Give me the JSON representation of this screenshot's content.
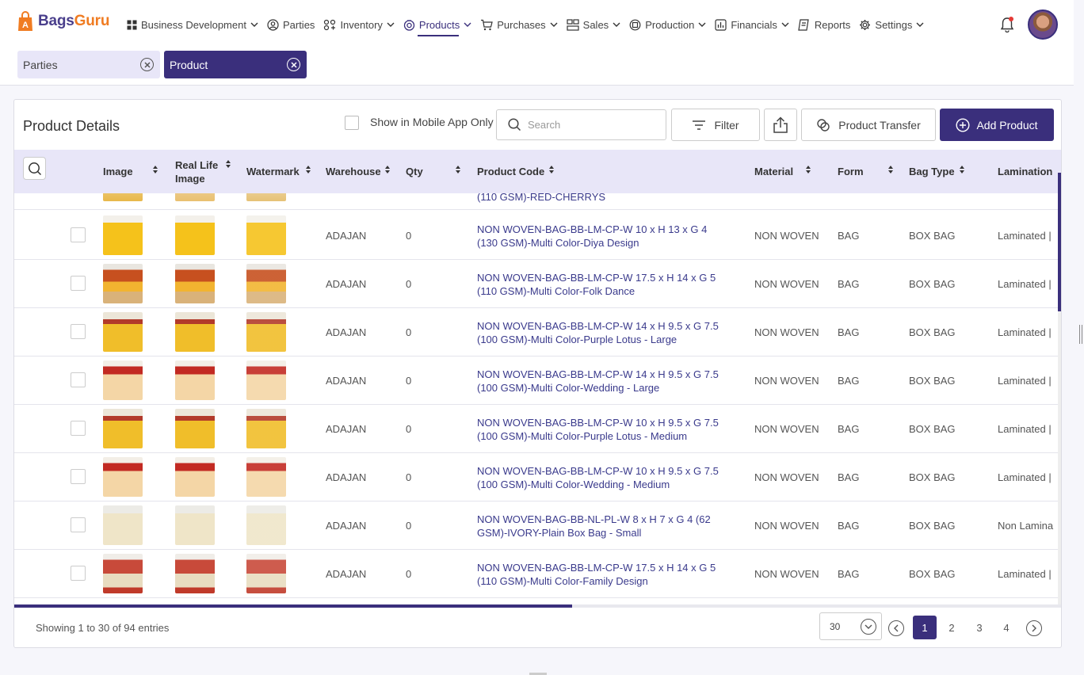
{
  "app": {
    "brand_part1": "Bags",
    "brand_part2": "Guru"
  },
  "nav": [
    {
      "label": "Business Development",
      "icon": "grid-icon",
      "dropdown": true
    },
    {
      "label": "Parties",
      "icon": "user-circle-icon",
      "dropdown": false
    },
    {
      "label": "Inventory",
      "icon": "inventory-icon",
      "dropdown": true
    },
    {
      "label": "Products",
      "icon": "product-icon",
      "dropdown": true,
      "active": true
    },
    {
      "label": "Purchases",
      "icon": "cart-icon",
      "dropdown": true
    },
    {
      "label": "Sales",
      "icon": "sales-icon",
      "dropdown": true
    },
    {
      "label": "Production",
      "icon": "production-icon",
      "dropdown": true
    },
    {
      "label": "Financials",
      "icon": "financials-icon",
      "dropdown": true
    },
    {
      "label": "Reports",
      "icon": "reports-icon",
      "dropdown": false
    },
    {
      "label": "Settings",
      "icon": "gear-icon",
      "dropdown": true
    }
  ],
  "tabs": [
    {
      "label": "Parties"
    },
    {
      "label": "Product"
    }
  ],
  "page": {
    "title": "Product Details",
    "mobile_only_label": "Show in Mobile App Only",
    "search_placeholder": "Search",
    "filter_label": "Filter",
    "transfer_label": "Product Transfer",
    "add_label": "Add Product"
  },
  "columns": [
    "Image",
    "Real Life Image",
    "Watermark",
    "Warehouse",
    "Qty",
    "Product Code",
    "Material",
    "Form",
    "Bag Type",
    "Lamination"
  ],
  "partial_row": {
    "product_code_tail": "(110 GSM)-RED-CHERRYS"
  },
  "rows": [
    {
      "warehouse": "ADAJAN",
      "qty": "0",
      "code1": "NON WOVEN-BAG-BB-LM-CP-W 10 x H 13 x G 4",
      "code2": "(130 GSM)-Multi Color-Diya Design",
      "material": "NON WOVEN",
      "form": "BAG",
      "bag_type": "BOX BAG",
      "lamination": "Laminated |",
      "img": "yellow"
    },
    {
      "warehouse": "ADAJAN",
      "qty": "0",
      "code1": "NON WOVEN-BAG-BB-LM-CP-W 17.5 x H 14 x G 5",
      "code2": "(110 GSM)-Multi Color-Folk Dance",
      "material": "NON WOVEN",
      "form": "BAG",
      "bag_type": "BOX BAG",
      "lamination": "Laminated |",
      "img": "folk"
    },
    {
      "warehouse": "ADAJAN",
      "qty": "0",
      "code1": "NON WOVEN-BAG-BB-LM-CP-W 14 x H 9.5 x G 7.5",
      "code2": "(100 GSM)-Multi Color-Purple Lotus - Large",
      "material": "NON WOVEN",
      "form": "BAG",
      "bag_type": "BOX BAG",
      "lamination": "Laminated |",
      "img": "lotus"
    },
    {
      "warehouse": "ADAJAN",
      "qty": "0",
      "code1": "NON WOVEN-BAG-BB-LM-CP-W 14 x H 9.5 x G 7.5",
      "code2": "(100 GSM)-Multi Color-Wedding - Large",
      "material": "NON WOVEN",
      "form": "BAG",
      "bag_type": "BOX BAG",
      "lamination": "Laminated |",
      "img": "wedding"
    },
    {
      "warehouse": "ADAJAN",
      "qty": "0",
      "code1": "NON WOVEN-BAG-BB-LM-CP-W 10 x H 9.5 x G 7.5",
      "code2": "(100 GSM)-Multi Color-Purple Lotus - Medium",
      "material": "NON WOVEN",
      "form": "BAG",
      "bag_type": "BOX BAG",
      "lamination": "Laminated |",
      "img": "lotus"
    },
    {
      "warehouse": "ADAJAN",
      "qty": "0",
      "code1": "NON WOVEN-BAG-BB-LM-CP-W 10 x H 9.5 x G 7.5",
      "code2": "(100 GSM)-Multi Color-Wedding - Medium",
      "material": "NON WOVEN",
      "form": "BAG",
      "bag_type": "BOX BAG",
      "lamination": "Laminated |",
      "img": "wedding"
    },
    {
      "warehouse": "ADAJAN",
      "qty": "0",
      "code1": "NON WOVEN-BAG-BB-NL-PL-W 8 x H 7 x G 4 (62",
      "code2": "GSM)-IVORY-Plain Box Bag - Small",
      "material": "NON WOVEN",
      "form": "BAG",
      "bag_type": "BOX BAG",
      "lamination": "Non Lamina",
      "img": "ivory"
    },
    {
      "warehouse": "ADAJAN",
      "qty": "0",
      "code1": "NON WOVEN-BAG-BB-LM-CP-W 17.5 x H 14 x G 5",
      "code2": "(110 GSM)-Multi Color-Family Design",
      "material": "NON WOVEN",
      "form": "BAG",
      "bag_type": "BOX BAG",
      "lamination": "Laminated |",
      "img": "family"
    }
  ],
  "footer": {
    "showing": "Showing 1 to 30 of 94 entries",
    "per_page": "30",
    "pages": [
      "1",
      "2",
      "3",
      "4"
    ],
    "current_page": "1"
  },
  "colors": {
    "primary": "#3a2f7c",
    "accent": "#f07c22",
    "header_bg": "#e8e6f8"
  }
}
